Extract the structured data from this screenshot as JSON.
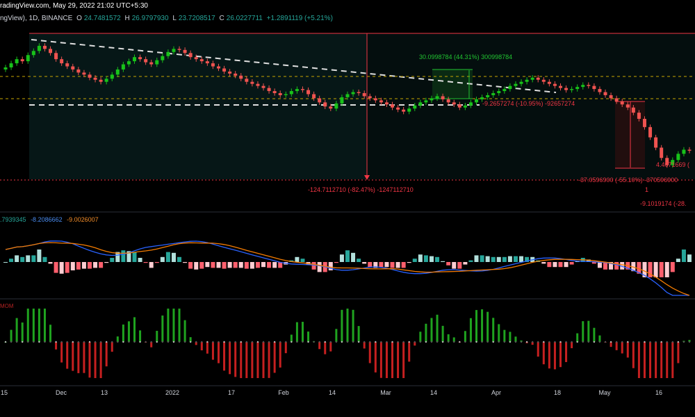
{
  "header": {
    "watermark": "radingView.com, May 29, 2022 21:02 UTC+5:30",
    "symbol": "ngView), 1D, BINANCE",
    "open_label": "O",
    "open": "24.7481572",
    "high_label": "H",
    "high": "26.9797930",
    "low_label": "L",
    "low": "23.7208517",
    "close_label": "C",
    "close": "26.0227711",
    "change": "+1.2891119 (+5.21%)"
  },
  "macd_legend": {
    "hist": ".7939345",
    "macd": "-8.2086662",
    "signal": "-9.0026007"
  },
  "squeeze_legend": "MOM",
  "colors": {
    "background": "#000000",
    "up": "#26a69a",
    "up_bright": "#18c21a",
    "down": "#ef5350",
    "macd_line": "#2962ff",
    "signal_line": "#f57c00",
    "measure_green": "#21c431",
    "measure_red": "#f23645",
    "yellow_dash": "#c8a600"
  },
  "chart_data": {
    "type": "candlestick",
    "interval": "1D",
    "exchange": "BINANCE",
    "x_tick_labels": [
      "15",
      "Dec",
      "13",
      "2022",
      "17",
      "Feb",
      "14",
      "Mar",
      "14",
      "Apr",
      "18",
      "May",
      "16"
    ],
    "price_closes": [
      180,
      184,
      188,
      186,
      192,
      196,
      201,
      198,
      194,
      188,
      184,
      181,
      178,
      175,
      173,
      170,
      168,
      166,
      169,
      173,
      178,
      183,
      186,
      190,
      188,
      185,
      183,
      187,
      191,
      195,
      198,
      197,
      194,
      190,
      188,
      186,
      184,
      181,
      179,
      176,
      174,
      172,
      169,
      166,
      164,
      162,
      160,
      157,
      155,
      153,
      154,
      157,
      159,
      158,
      154,
      150,
      146,
      142,
      140,
      145,
      151,
      154,
      156,
      155,
      152,
      150,
      148,
      146,
      144,
      141,
      139,
      137,
      140,
      143,
      146,
      148,
      150,
      152,
      149,
      146,
      144,
      141,
      143,
      146,
      149,
      151,
      153,
      155,
      157,
      159,
      162,
      164,
      166,
      168,
      170,
      168,
      166,
      164,
      162,
      160,
      158,
      159,
      161,
      163,
      162,
      159,
      156,
      153,
      150,
      147,
      144,
      141,
      136,
      130,
      122,
      112,
      102,
      92,
      85,
      90,
      96,
      100,
      99
    ],
    "annotations": [
      {
        "text": "30.0998784 (44.31%) 300998784",
        "color": "green"
      },
      {
        "text": "-9.2657274 (-10.95%) -92657274",
        "color": "red"
      },
      {
        "text": "-124.7112710 (-82.47%) -1247112710",
        "color": "red"
      },
      {
        "text": "-37.0596900 (-55.10%) -370596900",
        "color": "red"
      },
      {
        "text": "4.4071669 (",
        "color": "red"
      },
      {
        "text": "-9.1019174 (-28.",
        "color": "red"
      },
      {
        "text": "1",
        "color": "red"
      }
    ],
    "indicators": [
      "MACD",
      "Squeeze Momentum"
    ]
  }
}
